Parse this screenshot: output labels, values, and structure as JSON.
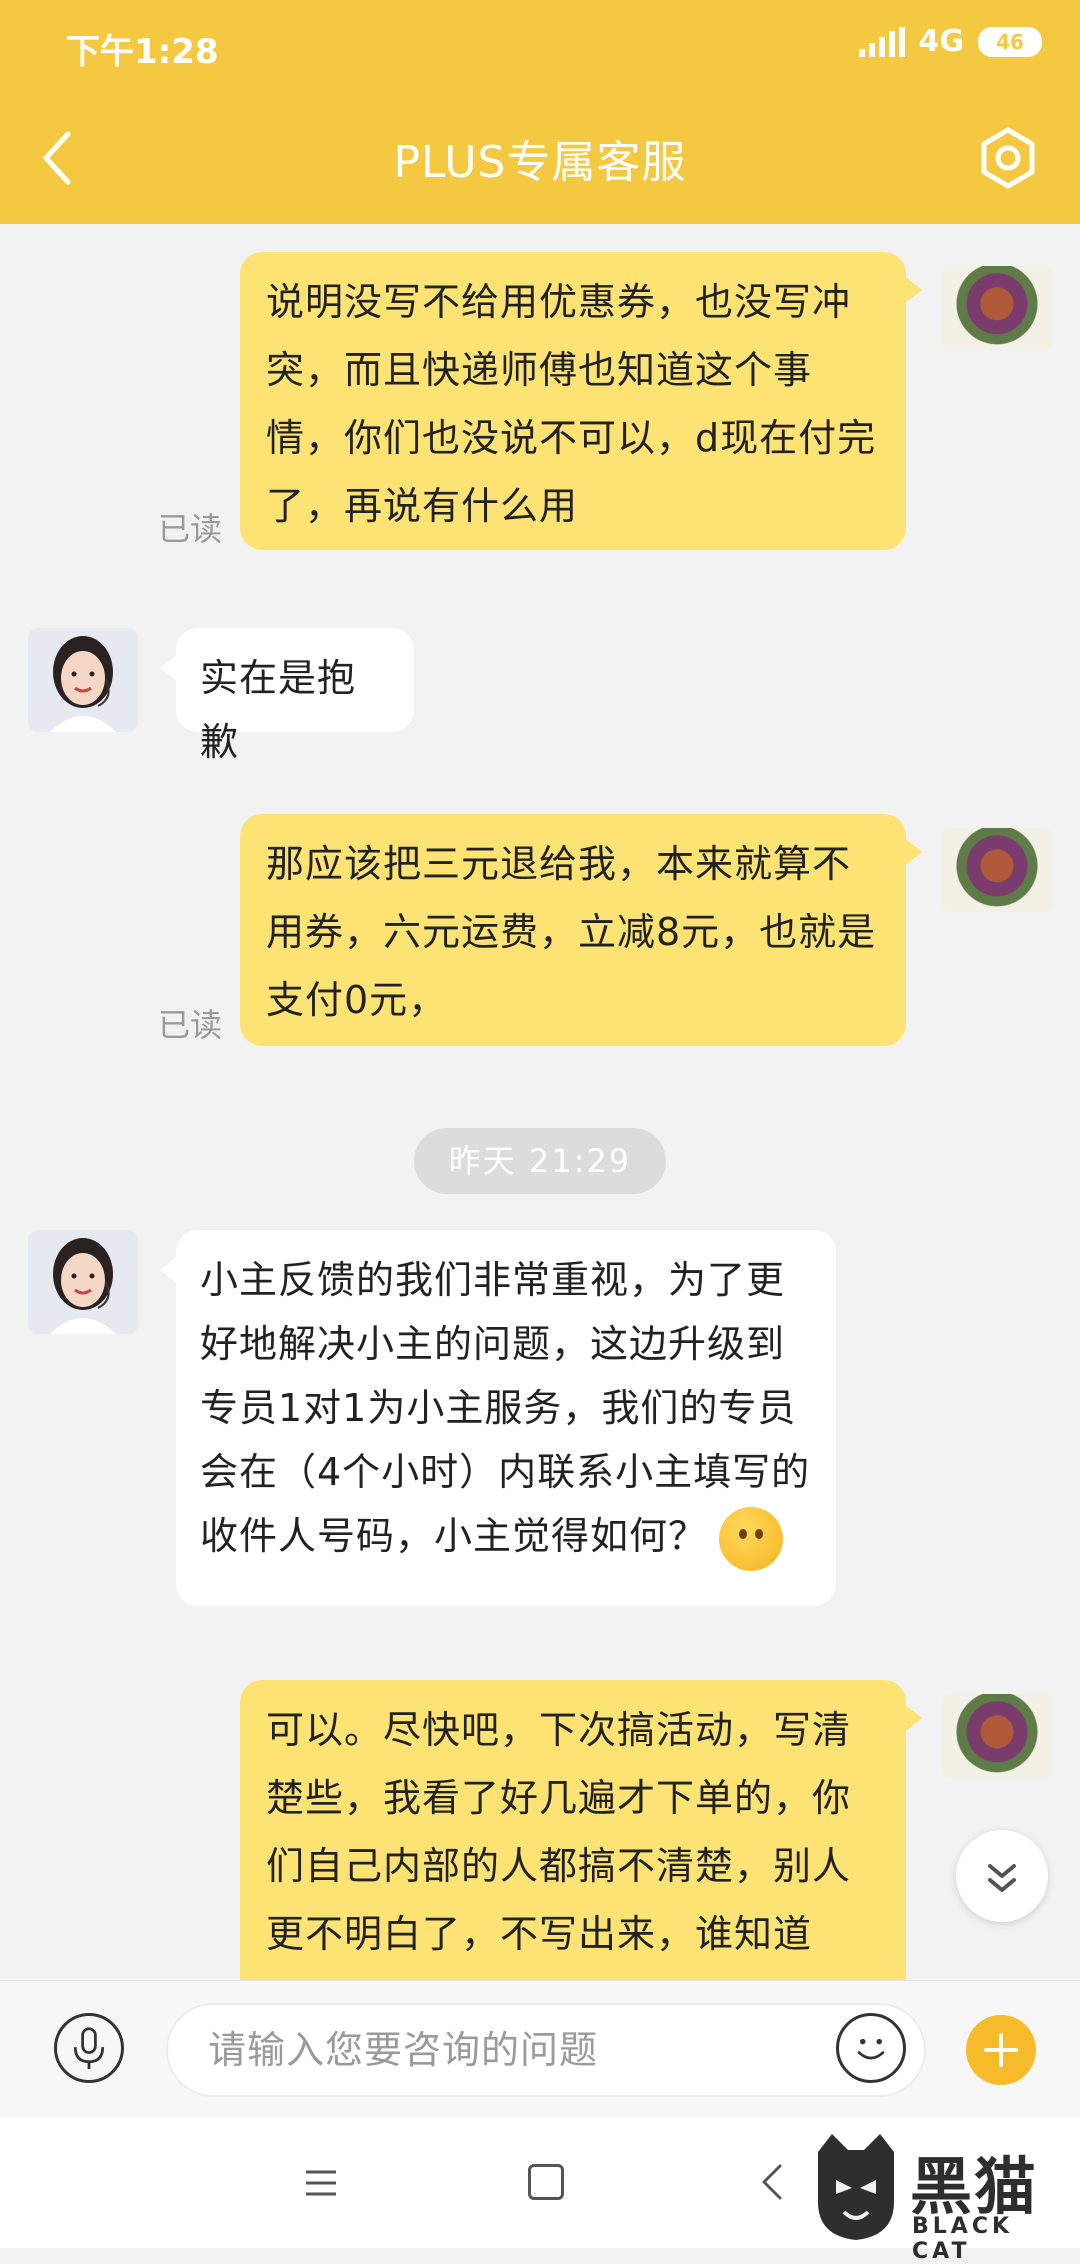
{
  "status_bar": {
    "time": "下午1:28",
    "network": "4G",
    "battery": "46"
  },
  "header": {
    "title": "PLUS专属客服",
    "back_icon": "chevron-left-icon",
    "settings_icon": "hexagon-gear-icon"
  },
  "messages": [
    {
      "sender": "user",
      "text": "说明没写不给用优惠券，也没写冲突，而且快递师傅也知道这个事情，你们也没说不可以，d现在付完了，再说有什么用",
      "read_label": "已读"
    },
    {
      "sender": "agent",
      "text": "实在是抱歉"
    },
    {
      "sender": "user",
      "text": "那应该把三元退给我，本来就算不用券，六元运费，立减8元，也就是支付0元，",
      "read_label": "已读"
    },
    {
      "sender": "agent",
      "text": "小主反馈的我们非常重视，为了更好地解决小主的问题，这边升级到专员1对1为小主服务，我们的专员会在（4个小时）内联系小主填写的收件人号码，小主觉得如何？"
    },
    {
      "sender": "user",
      "text": "可以。尽快吧，下次搞活动，写清楚些，我看了好几遍才下单的，你们自己内部的人都搞不清楚，别人更不明白了，不写出来，谁知道"
    }
  ],
  "time_divider": "昨天  21:29",
  "input": {
    "placeholder": "请输入您要咨询的问题"
  },
  "watermark": {
    "cn": "黑猫",
    "en": "BLACK CAT"
  },
  "colors": {
    "header": "#f5c842",
    "user_bubble": "#fde374",
    "agent_bubble": "#ffffff",
    "plus_button": "#f7ba2a"
  }
}
